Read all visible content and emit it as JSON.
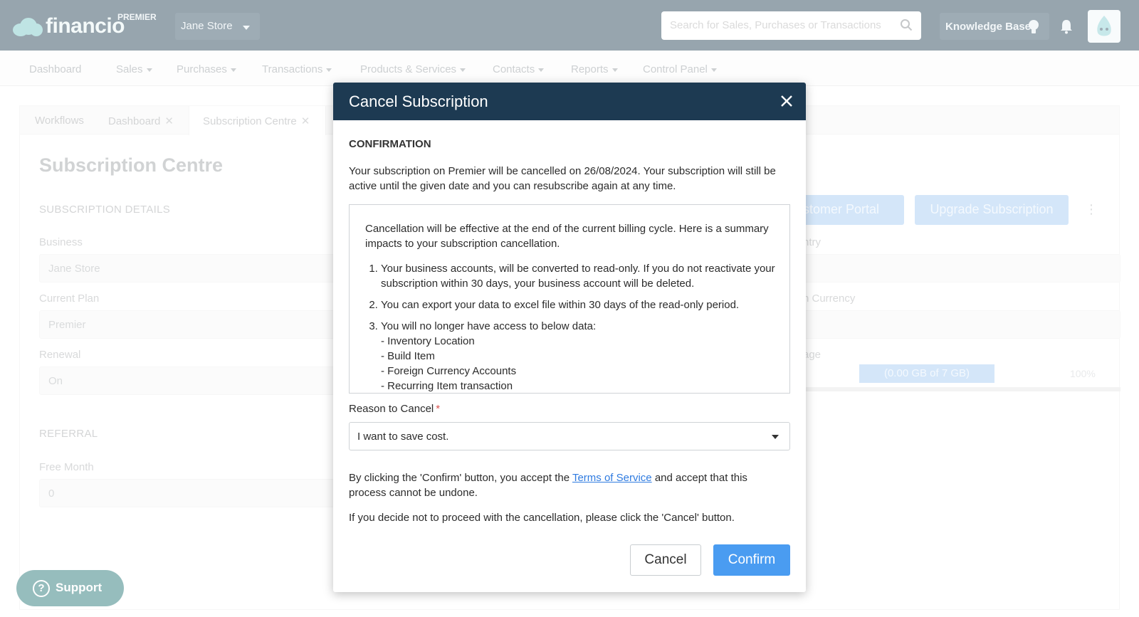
{
  "header": {
    "logo_text": "financio",
    "plan_badge": "PREMIER",
    "store_name": "Jane Store",
    "search_placeholder": "Search for Sales, Purchases or Transactions",
    "knowledge_base_label": "Knowledge Base"
  },
  "nav": {
    "items": [
      {
        "label": "Dashboard"
      },
      {
        "label": "Sales"
      },
      {
        "label": "Purchases"
      },
      {
        "label": "Transactions"
      },
      {
        "label": "Products & Services"
      },
      {
        "label": "Contacts"
      },
      {
        "label": "Reports"
      },
      {
        "label": "Control Panel"
      }
    ]
  },
  "tabs": [
    {
      "label": "Workflows"
    },
    {
      "label": "Dashboard"
    },
    {
      "label": "Subscription Centre"
    }
  ],
  "page": {
    "title": "Subscription Centre",
    "subscription_details_heading": "SUBSCRIPTION DETAILS",
    "business_label": "Business",
    "business_value": "Jane Store",
    "current_plan_label": "Current Plan",
    "current_plan_value": "Premier",
    "renewal_label": "Renewal",
    "renewal_value": "On",
    "referral_heading": "REFERRAL",
    "free_month_label": "Free Month",
    "free_month_value": "0",
    "customer_portal_label": "stomer Portal",
    "upgrade_label": "Upgrade Subscription",
    "country_label_partial": "ntry",
    "currency_label_partial": "n Currency",
    "storage_label_partial": "age",
    "storage_text": "(0.00 GB of 7 GB)",
    "storage_percent": "100%"
  },
  "support_label": "Support",
  "modal": {
    "title": "Cancel Subscription",
    "confirmation_heading": "CONFIRMATION",
    "intro": "Your subscription on Premier will be cancelled on 26/08/2024. Your subscription will still be active until the given date and you can resubscribe again at any time.",
    "impact_intro": "Cancellation will be effective at the end of the current billing cycle. Here is a summary impacts to your subscription cancellation.",
    "impact_items": [
      "Your business accounts, will be converted to read-only. If you do not reactivate your subscription within 30 days, your business account will be deleted.",
      "You can export your data to excel file within 30 days of the read-only period.",
      "You will no longer have access to below data:"
    ],
    "impact_subitems": [
      "- Inventory Location",
      "- Build Item",
      "- Foreign Currency Accounts",
      "- Recurring Item transaction"
    ],
    "reason_label": "Reason to Cancel",
    "reason_required_mark": "*",
    "reason_value": "I want to save cost.",
    "terms_prefix": "By clicking the 'Confirm' button, you accept the ",
    "terms_link": "Terms of Service",
    "terms_suffix": " and accept that this process cannot be undone.",
    "cancel_note": "If you decide not to proceed with the cancellation, please click the 'Cancel' button.",
    "cancel_button": "Cancel",
    "confirm_button": "Confirm"
  },
  "colors": {
    "modal_header": "#1d3a52",
    "confirm_button": "#4a9cf1",
    "topbar": "#2f4a5c",
    "support_button": "#2c7a7a"
  }
}
